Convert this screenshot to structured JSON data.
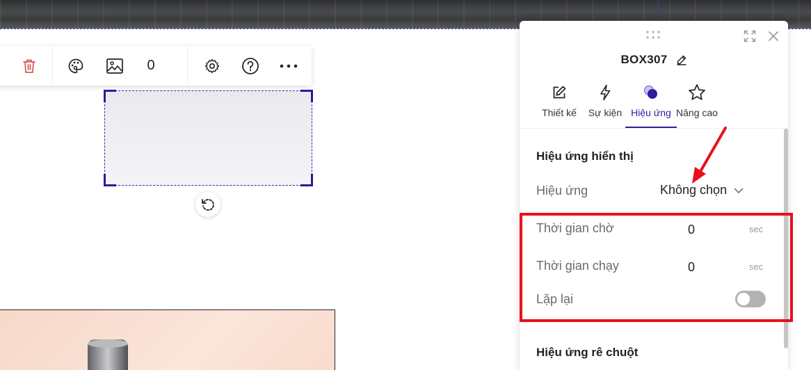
{
  "toolbar": {
    "count": "0",
    "icons": [
      "trash-icon",
      "palette-icon",
      "image-icon",
      "gear-icon",
      "help-icon",
      "more-icon"
    ]
  },
  "panel": {
    "title": "BOX307",
    "tabs": [
      {
        "label": "Thiết kế",
        "icon": "edit-icon"
      },
      {
        "label": "Sự kiện",
        "icon": "lightning-icon"
      },
      {
        "label": "Hiệu ứng",
        "icon": "effect-icon",
        "active": true
      },
      {
        "label": "Nâng cao",
        "icon": "star-icon"
      }
    ],
    "display_effects": {
      "title": "Hiệu ứng hiển thị",
      "effect_label": "Hiệu ứng",
      "effect_value": "Không chọn",
      "delay_label": "Thời gian chờ",
      "delay_value": "0",
      "delay_unit": "sec",
      "duration_label": "Thời gian chạy",
      "duration_value": "0",
      "duration_unit": "sec",
      "repeat_label": "Lặp lại",
      "repeat_on": false
    },
    "hover_effects": {
      "title": "Hiệu ứng rê chuột"
    }
  },
  "colors": {
    "accent": "#2d1ea0",
    "annotation": "#e8111b",
    "delete": "#d9534f"
  }
}
